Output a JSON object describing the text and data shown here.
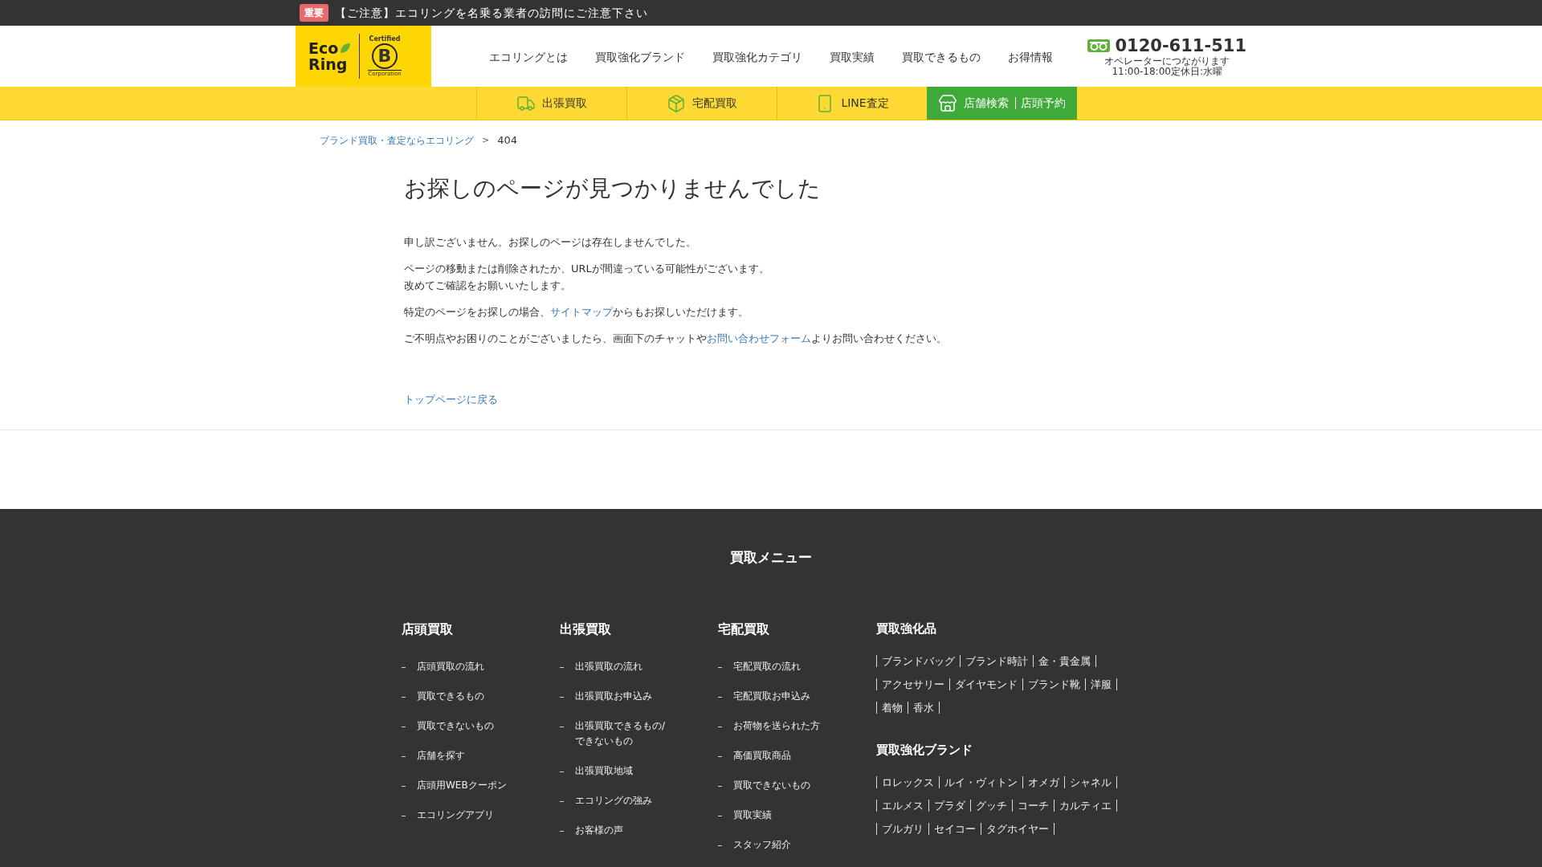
{
  "notice": {
    "badge": "重要",
    "text": "【ご注意】エコリングを名乗る業者の訪問にご注意下さい"
  },
  "logo": {
    "line1": "Eco",
    "line2": "Ring",
    "certified": "Certified",
    "b": "B",
    "corporation": "Corporation"
  },
  "nav": [
    "エコリングとは",
    "買取強化ブランド",
    "買取強化カテゴリ",
    "買取実績",
    "買取できるもの",
    "お得情報"
  ],
  "phone": {
    "number": "0120-611-511",
    "note": "オペレーターにつながります",
    "hours": "11:00-18:00定休日:水曜"
  },
  "subnav": [
    {
      "kind": "truck",
      "labels": [
        "出張買取"
      ],
      "selected": false
    },
    {
      "kind": "box",
      "labels": [
        "宅配買取"
      ],
      "selected": false
    },
    {
      "kind": "phone",
      "labels": [
        "LINE査定"
      ],
      "selected": false
    },
    {
      "kind": "store",
      "labels": [
        "店舗検索",
        "店頭予約"
      ],
      "selected": true
    }
  ],
  "breadcrumb": {
    "link": "ブランド買取・査定ならエコリング",
    "separator": ">",
    "current": "404"
  },
  "title": "お探しのページが見つかりませんでした",
  "paragraphs": [
    {
      "lines": [
        [
          {
            "text": "申し訳ございません。お探しのページは存在しませんでした。",
            "link": false
          }
        ]
      ]
    },
    {
      "lines": [
        [
          {
            "text": "ページの移動または削除されたか、URLが間違っている可能性がございます。",
            "link": false
          }
        ],
        [
          {
            "text": "改めてご確認をお願いいたします。",
            "link": false
          }
        ]
      ]
    },
    {
      "lines": [
        [
          {
            "text": "特定のページをお探しの場合、",
            "link": false
          },
          {
            "text": "サイトマップ",
            "link": true
          },
          {
            "text": "からもお探しいただけます。",
            "link": false
          }
        ]
      ]
    },
    {
      "lines": [
        [
          {
            "text": "ご不明点やお困りのことがございましたら、画面下のチャットや",
            "link": false
          },
          {
            "text": "お問い合わせフォーム",
            "link": true
          },
          {
            "text": "よりお問い合わせください。",
            "link": false
          }
        ]
      ]
    }
  ],
  "back_link": "トップページに戻る",
  "footer": {
    "title": "買取メニュー",
    "columns": [
      {
        "heading": "店頭買取",
        "items": [
          "店頭買取の流れ",
          "買取できるもの",
          "買取できないもの",
          "店舗を探す",
          "店頭用WEBクーポン",
          "エコリングアプリ"
        ]
      },
      {
        "heading": "出張買取",
        "items": [
          "出張買取の流れ",
          "出張買取お申込み",
          "出張買取できるもの/できないもの",
          "出張買取地域",
          "エコリングの強み",
          "お客様の声"
        ]
      },
      {
        "heading": "宅配買取",
        "items": [
          "宅配買取の流れ",
          "宅配買取お申込み",
          "お荷物を送られた方",
          "高価買取商品",
          "買取できないもの",
          "買取実績",
          "スタッフ紹介"
        ]
      }
    ],
    "tag_groups": [
      {
        "heading": "買取強化品",
        "tags": [
          "ブランドバッグ",
          "ブランド時計",
          "金・貴金属",
          "アクセサリー",
          "ダイヤモンド",
          "ブランド靴",
          "洋服",
          "着物",
          "香水"
        ]
      },
      {
        "heading": "買取強化ブランド",
        "tags": [
          "ロレックス",
          "ルイ・ヴィトン",
          "オメガ",
          "シャネル",
          "エルメス",
          "プラダ",
          "グッチ",
          "コーチ",
          "カルティエ",
          "ブルガリ",
          "セイコー",
          "タグホイヤー"
        ]
      }
    ]
  }
}
